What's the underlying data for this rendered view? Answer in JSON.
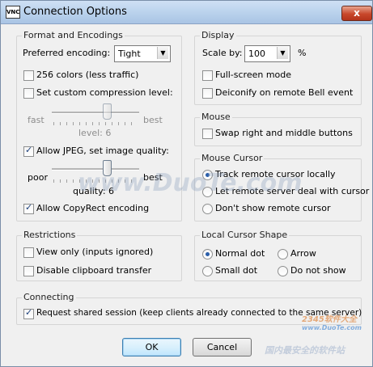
{
  "window": {
    "app_icon": "VNC",
    "title": "Connection Options",
    "close_glyph": "x"
  },
  "format": {
    "title": "Format and Encodings",
    "preferred_encoding_label": "Preferred encoding:",
    "encoding_value": "Tight",
    "colors256": {
      "label": "256 colors (less traffic)",
      "checked": false
    },
    "custom_compression": {
      "label": "Set custom compression level:",
      "checked": false
    },
    "compression": {
      "min_label": "fast",
      "max_label": "best",
      "level_text": "level: 6",
      "value": 6
    },
    "allow_jpeg": {
      "label": "Allow JPEG, set image quality:",
      "checked": true
    },
    "quality": {
      "min_label": "poor",
      "max_label": "best",
      "level_text": "quality: 6",
      "value": 6
    },
    "copyrect": {
      "label": "Allow CopyRect encoding",
      "checked": true
    }
  },
  "display": {
    "title": "Display",
    "scale_label": "Scale by:",
    "scale_value": "100",
    "scale_unit": "%",
    "fullscreen": {
      "label": "Full-screen mode",
      "checked": false
    },
    "deiconify": {
      "label": "Deiconify on remote Bell event",
      "checked": false
    }
  },
  "mouse": {
    "title": "Mouse",
    "swap": {
      "label": "Swap right and middle buttons",
      "checked": false
    }
  },
  "mouse_cursor": {
    "title": "Mouse Cursor",
    "options": [
      {
        "label": "Track remote cursor locally",
        "selected": true
      },
      {
        "label": "Let remote server deal with cursor",
        "selected": false
      },
      {
        "label": "Don't show remote cursor",
        "selected": false
      }
    ]
  },
  "restrictions": {
    "title": "Restrictions",
    "view_only": {
      "label": "View only (inputs ignored)",
      "checked": false
    },
    "disable_clipboard": {
      "label": "Disable clipboard transfer",
      "checked": false
    }
  },
  "local_cursor": {
    "title": "Local Cursor Shape",
    "options": [
      {
        "label": "Normal dot",
        "selected": true
      },
      {
        "label": "Arrow",
        "selected": false
      },
      {
        "label": "Small dot",
        "selected": false
      },
      {
        "label": "Do not show",
        "selected": false
      }
    ]
  },
  "connecting": {
    "title": "Connecting",
    "shared": {
      "label": "Request shared session (keep clients already connected to the same server)",
      "checked": true
    }
  },
  "buttons": {
    "ok": "OK",
    "cancel": "Cancel"
  },
  "watermark": {
    "main": "www.DuoTe.com",
    "site": "2345软件大全",
    "url": "www.DuoTe.com",
    "footer": "国内最安全的软件站"
  }
}
